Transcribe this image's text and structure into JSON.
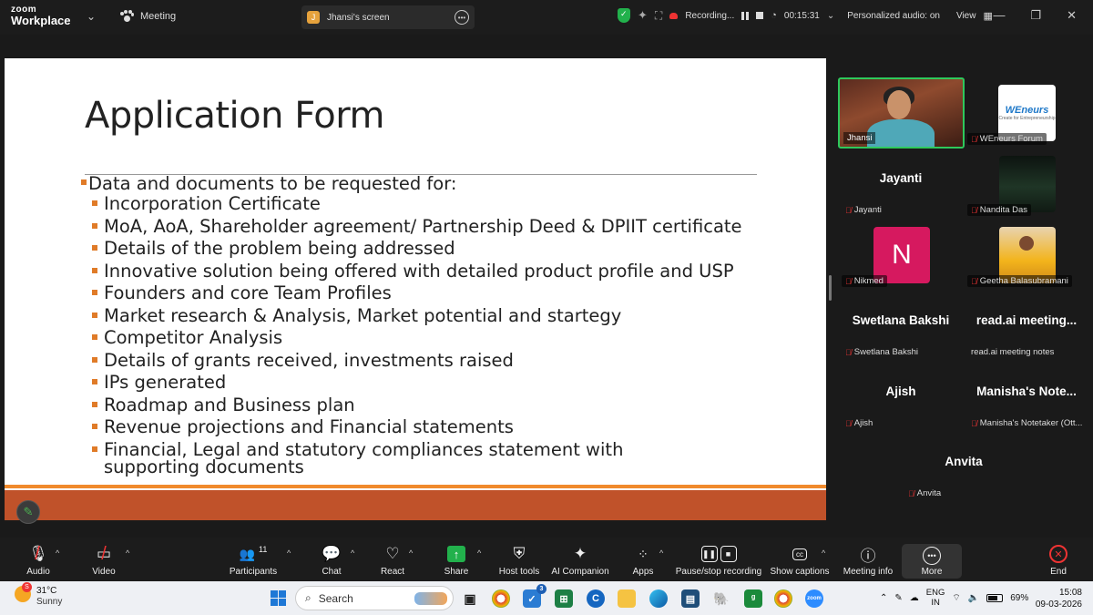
{
  "titlebar": {
    "logo_top": "zoom",
    "logo_bottom": "Workplace",
    "meeting_label": "Meeting",
    "screen_tab_initial": "J",
    "screen_tab_label": "Jhansi's screen",
    "recording_label": "Recording...",
    "timer": "00:15:31",
    "audio_label": "Personalized audio: on",
    "view_label": "View"
  },
  "slide": {
    "title": "Application Form",
    "main_bullet": "Data and documents to be requested for:",
    "items": [
      "Incorporation Certificate",
      "MoA, AoA, Shareholder agreement/ Partnership Deed & DPIIT certificate",
      "Details of the problem being addressed",
      "Innovative solution being offered with detailed product profile and USP",
      "Founders and core Team Profiles",
      "Market research & Analysis, Market potential and startegy",
      "Competitor Analysis",
      "Details of grants received, investments raised",
      "IPs generated",
      "Roadmap and Business plan",
      "Revenue projections and Financial statements",
      "Financial, Legal and statutory compliances statement with supporting documents"
    ],
    "accent_color": "#f08a2c",
    "footer_color": "#c0522a"
  },
  "participants": {
    "jhansi": "Jhansi",
    "weneurs_logo": "WEneurs",
    "weneurs_tag": "Create for Entrepreneurship",
    "weneurs": "WEneurs Forum",
    "jayanti_big": "Jayanti",
    "jayanti": "Jayanti",
    "nandita": "Nandita Das",
    "nikmed_initial": "N",
    "nikmed": "Nikmed",
    "geetha": "Geetha Balasubramani",
    "swetlana_big": "Swetlana Bakshi",
    "swetlana": "Swetlana Bakshi",
    "readai_big": "read.ai  meeting...",
    "readai": "read.ai meeting notes",
    "ajish_big": "Ajish",
    "ajish": "Ajish",
    "manisha_big": "Manisha's  Note...",
    "manisha": "Manisha's Notetaker (Ott...",
    "anvita_big": "Anvita",
    "anvita": "Anvita"
  },
  "toolbar": {
    "audio": "Audio",
    "video": "Video",
    "participants": "Participants",
    "participants_count": "11",
    "chat": "Chat",
    "react": "React",
    "share": "Share",
    "host_tools": "Host tools",
    "ai_companion": "AI Companion",
    "apps": "Apps",
    "pause_stop": "Pause/stop recording",
    "captions": "Show captions",
    "meeting_info": "Meeting info",
    "more": "More",
    "end": "End"
  },
  "taskbar": {
    "temp": "31°C",
    "weather": "Sunny",
    "weather_badge": "S",
    "search_placeholder": "Search",
    "todo_badge": "3",
    "lang_top": "ENG",
    "lang_bottom": "IN",
    "battery": "69%",
    "time": "15:08",
    "date": "09-03-2026"
  }
}
